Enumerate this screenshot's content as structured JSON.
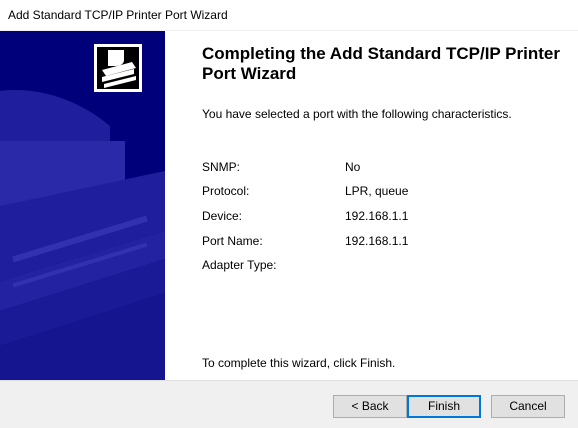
{
  "window": {
    "title": "Add Standard TCP/IP Printer Port Wizard"
  },
  "sidebar": {
    "icon": "printer-icon",
    "background_color": "#00007a"
  },
  "content": {
    "heading": "Completing the Add Standard TCP/IP Printer Port Wizard",
    "intro": "You have selected a port with the following characteristics.",
    "properties": [
      {
        "label": "SNMP:",
        "value": "No"
      },
      {
        "label": "Protocol:",
        "value": "LPR, queue"
      },
      {
        "label": "Device:",
        "value": "192.168.1.1"
      },
      {
        "label": "Port Name:",
        "value": "192.168.1.1"
      },
      {
        "label": "Adapter Type:",
        "value": ""
      }
    ],
    "footer": "To complete this wizard, click Finish."
  },
  "buttons": {
    "back": "< Back",
    "finish": "Finish",
    "cancel": "Cancel"
  },
  "colors": {
    "accent": "#0078d7",
    "sidebar": "#00007a"
  }
}
